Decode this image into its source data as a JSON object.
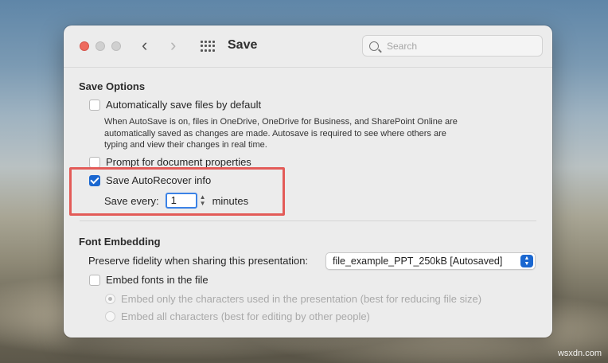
{
  "window": {
    "title": "Save"
  },
  "search": {
    "placeholder": "Search"
  },
  "save_options": {
    "heading": "Save Options",
    "autosave_label": "Automatically save files by default",
    "autosave_checked": false,
    "autosave_description": [
      "When AutoSave is on, files in OneDrive, OneDrive for Business, and SharePoint Online are",
      "automatically saved as changes are made. Autosave is required to see where others are",
      "typing and view their changes in real time."
    ],
    "prompt_properties_label": "Prompt for document properties",
    "prompt_properties_checked": false,
    "autorecover_label": "Save AutoRecover info",
    "autorecover_checked": true,
    "save_every_label": "Save every:",
    "save_every_value": "1",
    "minutes_label": "minutes"
  },
  "font_embedding": {
    "heading": "Font Embedding",
    "preserve_label": "Preserve fidelity when sharing this presentation:",
    "preserve_selected": "file_example_PPT_250kB [Autosaved]",
    "embed_fonts_label": "Embed fonts in the file",
    "embed_fonts_checked": false,
    "embed_only_used_label": "Embed only the characters used in the presentation (best for reducing file size)",
    "embed_all_label": "Embed all characters (best for editing by other people)"
  },
  "colors": {
    "highlight": "#e35b58",
    "accent": "#1a67d0"
  },
  "watermark": "wsxdn.com"
}
